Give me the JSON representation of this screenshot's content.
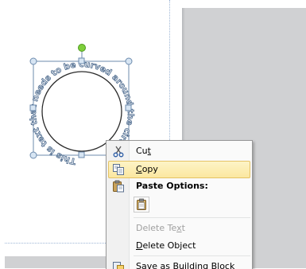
{
  "document": {
    "curved_text": "This is text that needs to be curved around the circle"
  },
  "context_menu": {
    "items": [
      {
        "label_pre": "Cu",
        "label_key": "t",
        "label_post": "",
        "icon": "scissors-icon",
        "state": "normal"
      },
      {
        "label_pre": "",
        "label_key": "C",
        "label_post": "opy",
        "icon": "copy-icon",
        "state": "highlighted"
      },
      {
        "label_pre": "",
        "label_key": "",
        "label_post": "Paste Options:",
        "icon": "paste-icon",
        "state": "header"
      },
      {
        "label_pre": "Delete Te",
        "label_key": "x",
        "label_post": "t",
        "icon": "",
        "state": "disabled"
      },
      {
        "label_pre": "",
        "label_key": "D",
        "label_post": "elete Object",
        "icon": "",
        "state": "normal"
      },
      {
        "label_pre": "Save as Building Block",
        "label_key": "",
        "label_post": "",
        "icon": "building-block-icon",
        "state": "normal"
      }
    ],
    "paste_option_icon": "paste-keep-formatting-icon"
  },
  "colors": {
    "selection_outline": "#6d8bad",
    "rotation_handle": "#7ecf3a",
    "menu_highlight": "#fbe7a0",
    "workspace_gray": "#d0d1d3"
  }
}
